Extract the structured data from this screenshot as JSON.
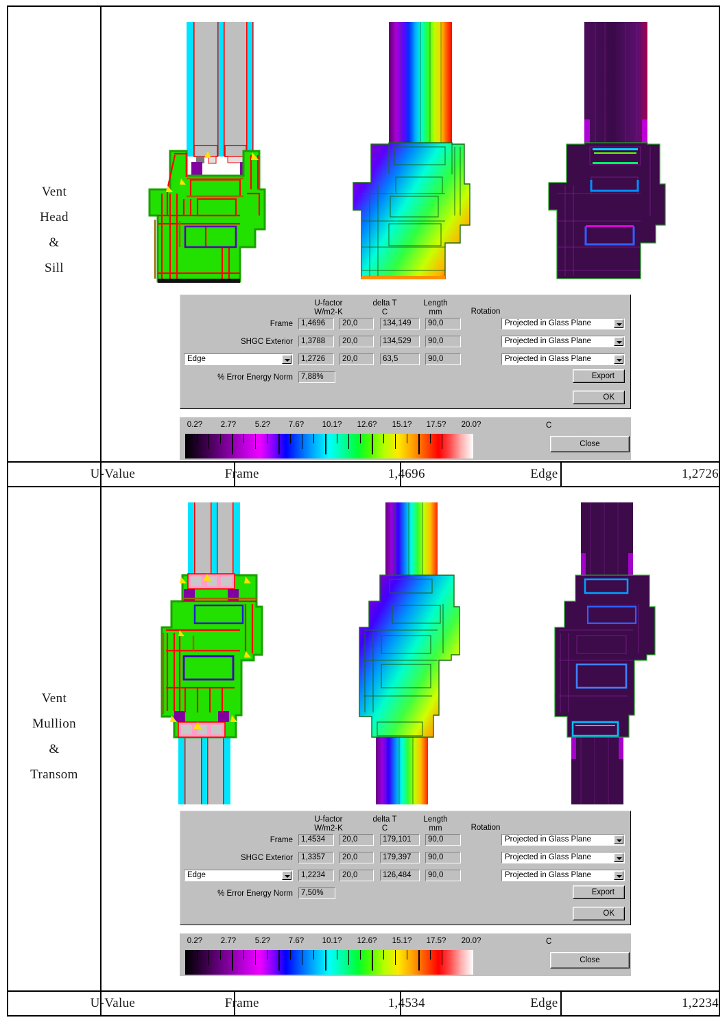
{
  "table": {
    "sections": [
      {
        "label_lines": [
          "Vent",
          "Head",
          "&",
          "Sill"
        ],
        "uvalue": {
          "row_label": "U-Value",
          "frame_label": "Frame",
          "frame_value": "1,4696",
          "edge_label": "Edge",
          "edge_value": "1,2726"
        },
        "dialog": {
          "headers": {
            "ufactor_line1": "U-factor",
            "ufactor_line2": "W/m2-K",
            "deltat_line1": "delta T",
            "deltat_line2": "C",
            "length_line1": "Length",
            "length_line2": "mm",
            "rotation": "Rotation"
          },
          "rows": [
            {
              "name": "Frame",
              "ufactor": "1,4696",
              "delta_t": "20,0",
              "length": "134,149",
              "rotation": "90,0",
              "projection": "Projected in Glass Plane"
            },
            {
              "name": "SHGC Exterior",
              "ufactor": "1,3788",
              "delta_t": "20,0",
              "length": "134,529",
              "rotation": "90,0",
              "projection": "Projected in Glass Plane"
            },
            {
              "name": "Edge",
              "ufactor": "1,2726",
              "delta_t": "20,0",
              "length": "63,5",
              "rotation": "90,0",
              "projection": "Projected in Glass Plane"
            }
          ],
          "error_label": "% Error Energy Norm",
          "error_value": "7,88%",
          "export_label": "Export",
          "ok_label": "OK"
        },
        "legend": {
          "ticks": [
            "0.2?",
            "2.7?",
            "5.2?",
            "7.6?",
            "10.1?",
            "12.6?",
            "15.1?",
            "17.5?",
            "20.0?"
          ],
          "unit": "C",
          "close_label": "Close"
        }
      },
      {
        "label_lines": [
          "Vent",
          "Mullion",
          "&",
          "Transom"
        ],
        "uvalue": {
          "row_label": "U-Value",
          "frame_label": "Frame",
          "frame_value": "1,4534",
          "edge_label": "Edge",
          "edge_value": "1,2234"
        },
        "dialog": {
          "headers": {
            "ufactor_line1": "U-factor",
            "ufactor_line2": "W/m2-K",
            "deltat_line1": "delta T",
            "deltat_line2": "C",
            "length_line1": "Length",
            "length_line2": "mm",
            "rotation": "Rotation"
          },
          "rows": [
            {
              "name": "Frame",
              "ufactor": "1,4534",
              "delta_t": "20,0",
              "length": "179,101",
              "rotation": "90,0",
              "projection": "Projected in Glass Plane"
            },
            {
              "name": "SHGC Exterior",
              "ufactor": "1,3357",
              "delta_t": "20,0",
              "length": "179,397",
              "rotation": "90,0",
              "projection": "Projected in Glass Plane"
            },
            {
              "name": "Edge",
              "ufactor": "1,2234",
              "delta_t": "20,0",
              "length": "126,484",
              "rotation": "90,0",
              "projection": "Projected in Glass Plane"
            }
          ],
          "error_label": "% Error Energy Norm",
          "error_value": "7,50%",
          "export_label": "Export",
          "ok_label": "OK"
        },
        "legend": {
          "ticks": [
            "0.2?",
            "2.7?",
            "5.2?",
            "7.6?",
            "10.1?",
            "12.6?",
            "15.1?",
            "17.5?",
            "20.0?"
          ],
          "unit": "C",
          "close_label": "Close"
        }
      }
    ]
  },
  "figures": {
    "materials_caption": "material-cross-section",
    "isotherm_caption": "temperature-gradient",
    "fluxmap_caption": "heat-flux-map"
  },
  "colors": {
    "dialog_face": "#c0c0c0",
    "material_fill": "#22e000",
    "glass_fill": "#c0c0c0",
    "glazing_edge": "#00e5ff",
    "seal_red": "#ff0000",
    "flux_dark": "#3d0a4a"
  }
}
